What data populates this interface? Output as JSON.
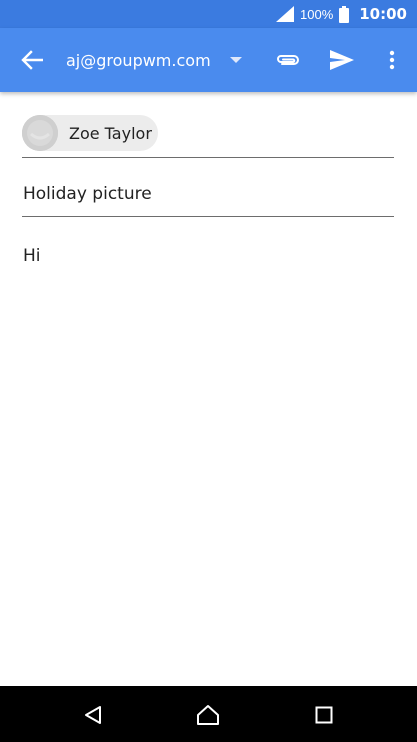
{
  "status_bar": {
    "battery_percent": "100%",
    "time": "10:00",
    "icons": [
      "signal-icon",
      "battery-icon"
    ]
  },
  "app_bar": {
    "account": "aj@groupwm.com",
    "icons": [
      "back-arrow-icon",
      "dropdown-icon",
      "paperclip-icon",
      "send-icon",
      "more-vert-icon"
    ]
  },
  "compose": {
    "to_recipient": "Zoe Taylor",
    "subject": "Holiday picture",
    "body": "Hi"
  },
  "nav_bar": {
    "icons": [
      "back-triangle-icon",
      "home-icon",
      "recents-square-icon"
    ]
  },
  "colors": {
    "status_bar": "#3b7be0",
    "app_bar": "#4a8bee",
    "divider": "#6d6d6d",
    "chip": "#ececec",
    "nav_bar": "#000000"
  }
}
